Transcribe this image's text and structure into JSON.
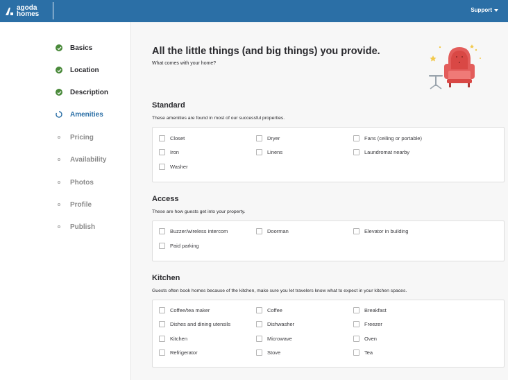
{
  "brand": {
    "line1": "agoda",
    "line2": "homes",
    "color": "#2b6fa6"
  },
  "support": {
    "label": "Support"
  },
  "steps": [
    {
      "label": "Basics",
      "status": "done"
    },
    {
      "label": "Location",
      "status": "done"
    },
    {
      "label": "Description",
      "status": "done"
    },
    {
      "label": "Amenities",
      "status": "current"
    },
    {
      "label": "Pricing",
      "status": "todo"
    },
    {
      "label": "Availability",
      "status": "todo"
    },
    {
      "label": "Photos",
      "status": "todo"
    },
    {
      "label": "Profile",
      "status": "todo"
    },
    {
      "label": "Publish",
      "status": "todo"
    }
  ],
  "page": {
    "title": "All the little things (and big things) you provide.",
    "subtitle": "What comes with your home?"
  },
  "sections": {
    "standard": {
      "title": "Standard",
      "description": "These amenities are found in most of our successful properties.",
      "items": [
        "Closet",
        "Dryer",
        "Fans (ceiling or portable)",
        "Iron",
        "Linens",
        "Laundromat nearby",
        "Washer"
      ]
    },
    "access": {
      "title": "Access",
      "description": "These are how guests get into your property.",
      "items": [
        "Buzzer/wireless intercom",
        "Doorman",
        "Elevator in building",
        "Paid parking"
      ]
    },
    "kitchen": {
      "title": "Kitchen",
      "description": "Guests often book homes because of the kitchen, make sure you let travelers know what to expect in your kitchen spaces.",
      "items": [
        "Coffee/tea maker",
        "Coffee",
        "Breakfast",
        "Dishes and dining utensils",
        "Dishwasher",
        "Freezer",
        "Kitchen",
        "Microwave",
        "Oven",
        "Refrigerator",
        "Stove",
        "Tea"
      ]
    }
  },
  "colors": {
    "done": "#4a8a3b",
    "current": "#2b6fa6",
    "todo": "#8a8a8a"
  }
}
